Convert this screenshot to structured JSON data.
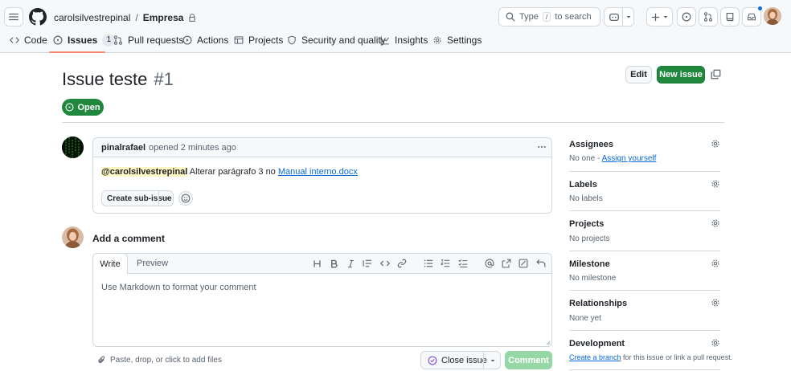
{
  "header": {
    "owner": "carolsilvestrepinal",
    "separator": "/",
    "repo": "Empresa",
    "search_placeholder": "Type / to search",
    "search_prefix": "Type",
    "search_key": "/",
    "search_suffix": "to search"
  },
  "tabs": [
    {
      "label": "Code",
      "icon": "code-icon"
    },
    {
      "label": "Issues",
      "icon": "issue-opened-icon",
      "count": "1",
      "selected": true
    },
    {
      "label": "Pull requests",
      "icon": "git-pull-request-icon"
    },
    {
      "label": "Actions",
      "icon": "play-icon"
    },
    {
      "label": "Projects",
      "icon": "table-icon"
    },
    {
      "label": "Security and quality",
      "icon": "shield-icon"
    },
    {
      "label": "Insights",
      "icon": "graph-icon"
    },
    {
      "label": "Settings",
      "icon": "gear-icon"
    }
  ],
  "issue": {
    "title": "Issue teste",
    "number": "#1",
    "state": "Open",
    "edit_label": "Edit",
    "new_issue_label": "New issue"
  },
  "comment": {
    "author": "pinalrafael",
    "meta": "opened 2 minutes ago",
    "mention": "@carolsilvestrepinal",
    "body_text": " Alterar parágrafo 3 no ",
    "link_text": "Manual interno.docx",
    "sub_issue_label": "Create sub-issue"
  },
  "composer": {
    "heading": "Add a comment",
    "write_tab": "Write",
    "preview_tab": "Preview",
    "placeholder": "Use Markdown to format your comment",
    "attach_hint": "Paste, drop, or click to add files",
    "close_issue_label": "Close issue",
    "comment_label": "Comment"
  },
  "sidebar": {
    "assignees": {
      "title": "Assignees",
      "none_text": "No one - ",
      "assign_link": "Assign yourself"
    },
    "labels": {
      "title": "Labels",
      "value": "No labels"
    },
    "projects": {
      "title": "Projects",
      "value": "No projects"
    },
    "milestone": {
      "title": "Milestone",
      "value": "No milestone"
    },
    "relationships": {
      "title": "Relationships",
      "value": "None yet"
    },
    "development": {
      "title": "Development",
      "link": "Create a branch",
      "rest": " for this issue or link a pull request."
    }
  },
  "colors": {
    "accent_green": "#1f883d",
    "link_blue": "#0969da",
    "tab_underline": "#fd8c73",
    "notification_dot": "#0969da"
  }
}
